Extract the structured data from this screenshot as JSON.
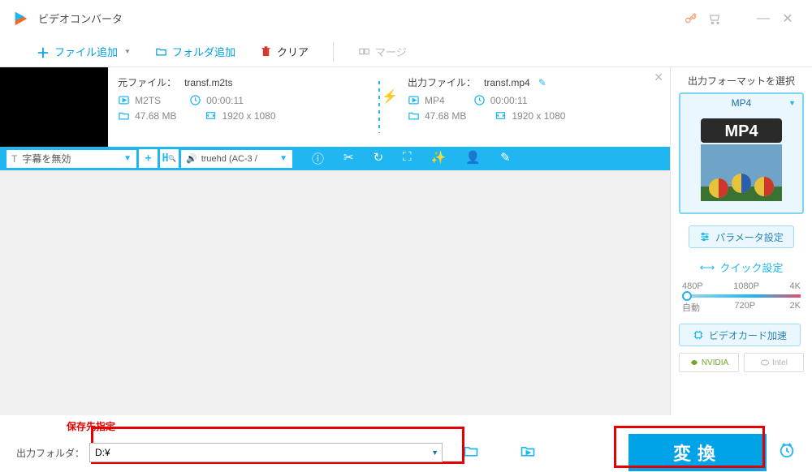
{
  "app": {
    "title": "ビデオコンバータ"
  },
  "toolbar": {
    "add_file": "ファイル追加",
    "add_folder": "フォルダ追加",
    "clear": "クリア",
    "merge": "マージ"
  },
  "item": {
    "src_label": "元ファイル：",
    "src_name": "transf.m2ts",
    "out_label": "出力ファイル：",
    "out_name": "transf.mp4",
    "src_container": "M2TS",
    "out_container": "MP4",
    "src_duration": "00:00:11",
    "out_duration": "00:00:11",
    "src_size": "47.68 MB",
    "out_size": "47.68 MB",
    "src_dims": "1920 x 1080",
    "out_dims": "1920 x 1080",
    "subtitle": "字幕を無効",
    "audio": "truehd (AC-3 / "
  },
  "right_panel": {
    "title": "出力フォーマットを選択",
    "format": "MP4",
    "format_badge": "MP4",
    "params_btn": "パラメータ設定",
    "quick_title": "クイック設定",
    "ticks_top": [
      "480P",
      "1080P",
      "4K"
    ],
    "ticks_bot": [
      "自動",
      "720P",
      "2K"
    ],
    "gpu_btn": "ビデオカード加速",
    "nvidia": "NVIDIA",
    "intel": "Intel"
  },
  "bottom": {
    "save_hint": "保存先指定",
    "out_label": "出力フォルダ：",
    "out_value": "D:¥",
    "convert": "変換"
  }
}
